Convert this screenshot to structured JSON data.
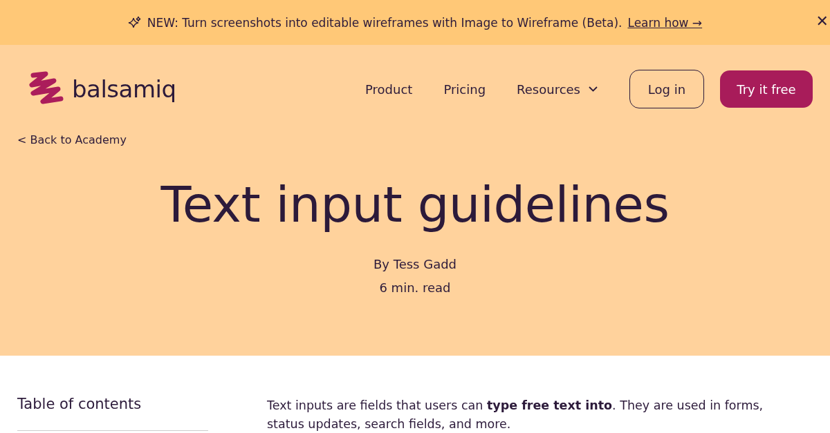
{
  "banner": {
    "text": "NEW: Turn screenshots into editable wireframes with Image to Wireframe (Beta).",
    "link": "Learn how →",
    "close": "✕"
  },
  "header": {
    "logo": "balsamiq",
    "nav": [
      {
        "label": "Product",
        "kind": "link"
      },
      {
        "label": "Pricing",
        "kind": "link"
      },
      {
        "label": "Resources",
        "kind": "dropdown"
      }
    ],
    "login": "Log in",
    "cta": "Try it free"
  },
  "hero": {
    "back": "< Back to Academy",
    "title": "Text input guidelines",
    "author": "By Tess Gadd",
    "read_time": "6 min. read"
  },
  "toc": {
    "title": "Table of contents"
  },
  "intro": "Text inputs are fields that users can **type free text into**. They are used in forms, status updates, search fields, and more."
}
